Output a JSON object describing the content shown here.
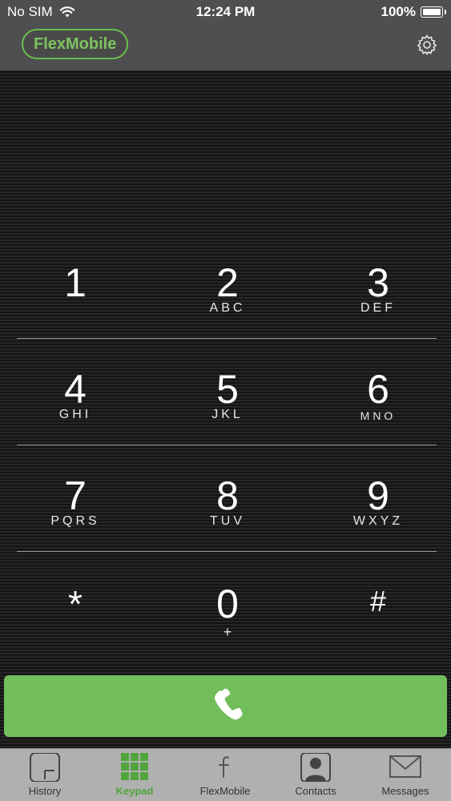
{
  "status_bar": {
    "carrier": "No SIM",
    "time": "12:24 PM",
    "battery": "100%"
  },
  "header": {
    "brand": "FlexMobile",
    "settings_icon": "gear-icon"
  },
  "keypad": {
    "keys": [
      {
        "digit": "1",
        "letters": ""
      },
      {
        "digit": "2",
        "letters": "ABC"
      },
      {
        "digit": "3",
        "letters": "DEF"
      },
      {
        "digit": "4",
        "letters": "GHI"
      },
      {
        "digit": "5",
        "letters": "JKL"
      },
      {
        "digit": "6",
        "letters": "MNO"
      },
      {
        "digit": "7",
        "letters": "PQRS"
      },
      {
        "digit": "8",
        "letters": "TUV"
      },
      {
        "digit": "9",
        "letters": "WXYZ"
      },
      {
        "digit": "*",
        "letters": ""
      },
      {
        "digit": "0",
        "letters": "+"
      },
      {
        "digit": "#",
        "letters": ""
      }
    ]
  },
  "call_button": {
    "icon": "phone-icon",
    "color": "#72bd5c"
  },
  "tabbar": {
    "tabs": [
      {
        "label": "History",
        "icon": "history-icon",
        "active": false
      },
      {
        "label": "Keypad",
        "icon": "keypad-icon",
        "active": true
      },
      {
        "label": "FlexMobile",
        "icon": "flexmobile-icon",
        "active": false
      },
      {
        "label": "Contacts",
        "icon": "contacts-icon",
        "active": false
      },
      {
        "label": "Messages",
        "icon": "messages-icon",
        "active": false
      }
    ]
  },
  "colors": {
    "accent": "#72bd5c",
    "header_bg": "#4f4f4f",
    "tab_bg": "#b0b0b0"
  }
}
